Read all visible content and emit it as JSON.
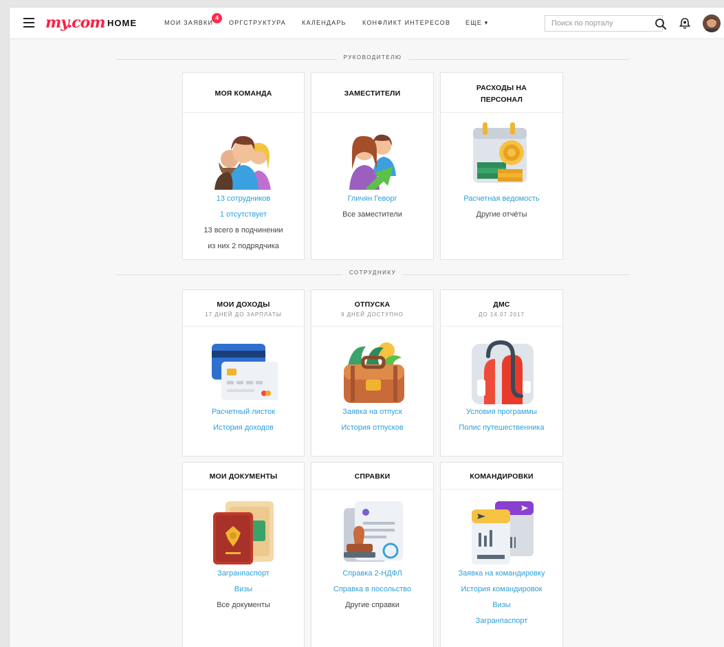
{
  "header": {
    "logo": "my.com",
    "home": "HOME",
    "nav": [
      {
        "label": "МОИ ЗАЯВКИ"
      },
      {
        "label": "ОРГСТРУКТУРА"
      },
      {
        "label": "КАЛЕНДАРЬ"
      },
      {
        "label": "КОНФЛИКТ ИНТЕРЕСОВ"
      },
      {
        "label": "ЕЩЕ ▾"
      }
    ],
    "requests_badge": "4",
    "search_placeholder": "Поиск по порталу"
  },
  "sections": {
    "manager": "РУКОВОДИТЕЛЮ",
    "employee": "СОТРУДНИКУ"
  },
  "cards": {
    "team": {
      "title": "МОЯ КОМАНДА",
      "icon": "team-illustration",
      "links": [
        "13 сотрудников",
        "1 отсутствует"
      ],
      "texts": [
        "13 всего в подчинении",
        "из них 2 подрядчика"
      ]
    },
    "deputies": {
      "title": "ЗАМЕСТИТЕЛИ",
      "icon": "deputies-illustration",
      "links": [
        "Гличян Геворг"
      ],
      "texts": [
        "Все заместители"
      ]
    },
    "expenses": {
      "title": "РАСХОДЫ НА ПЕРСОНАЛ",
      "icon": "payroll-illustration",
      "links": [
        "Расчетная ведомость"
      ],
      "texts": [
        "Другие отчёты"
      ]
    },
    "income": {
      "title": "МОИ ДОХОДЫ",
      "subtitle": "17 ДНЕЙ ДО ЗАРПЛАТЫ",
      "icon": "bank-cards-illustration",
      "links": [
        "Расчетный листок",
        "История доходов"
      ]
    },
    "vacation": {
      "title": "ОТПУСКА",
      "subtitle": "9 ДНЕЙ ДОСТУПНО",
      "icon": "suitcase-illustration",
      "links": [
        "Заявка на отпуск",
        "История отпусков"
      ]
    },
    "dms": {
      "title": "ДМС",
      "subtitle": "ДО 14.07.2017",
      "icon": "insurance-illustration",
      "links": [
        "Условия программы",
        "Полис путешественника"
      ]
    },
    "documents": {
      "title": "МОИ ДОКУМЕНТЫ",
      "icon": "passport-illustration",
      "links": [
        "Загранпаспорт",
        "Визы"
      ],
      "texts": [
        "Все документы"
      ]
    },
    "certificates": {
      "title": "СПРАВКИ",
      "icon": "stamp-illustration",
      "links": [
        "Справка 2-НДФЛ",
        "Справка в посольство"
      ],
      "texts": [
        "Другие справки"
      ]
    },
    "trips": {
      "title": "КОМАНДИРОВКИ",
      "icon": "tickets-illustration",
      "links": [
        "Заявка на командировку",
        "История командировок",
        "Визы",
        "Загранпаспорт"
      ]
    }
  },
  "colors": {
    "brand": "#ff1f44",
    "link": "#2a9fd8",
    "badge": "#ff2b4a"
  }
}
